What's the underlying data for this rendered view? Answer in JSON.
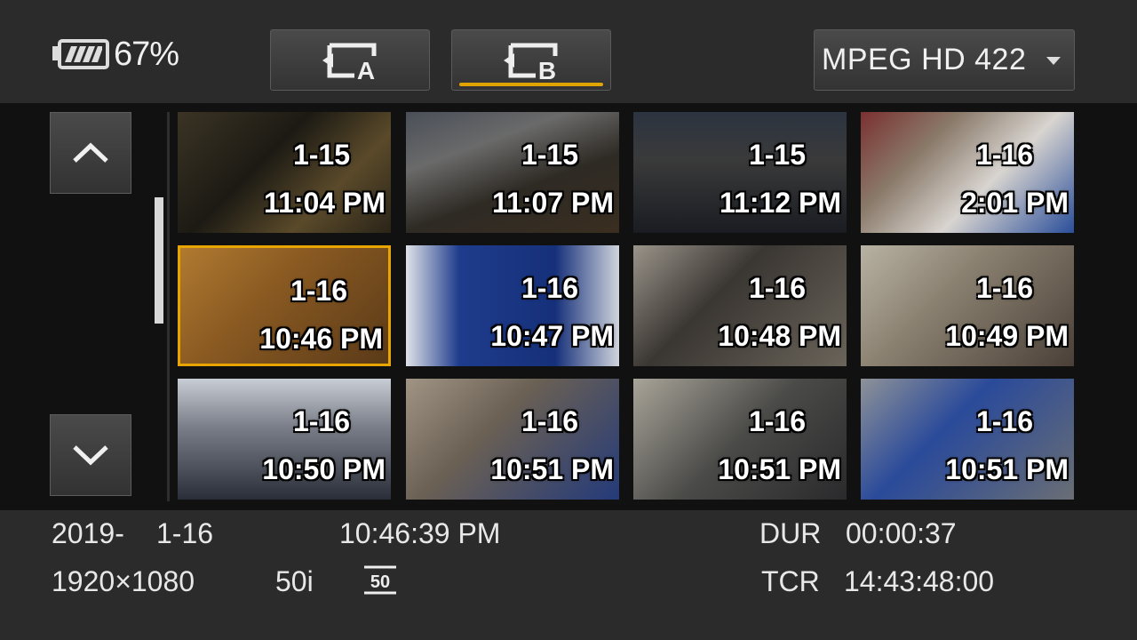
{
  "status": {
    "battery_percent": "67%"
  },
  "slots": [
    {
      "label": "A",
      "active": false
    },
    {
      "label": "B",
      "active": true
    }
  ],
  "format": {
    "label": "MPEG HD 422",
    "icon": "dropdown-arrow-icon"
  },
  "navigation": {
    "up_icon": "chevron-up-icon",
    "down_icon": "chevron-down-icon"
  },
  "thumbnails": [
    {
      "date": "1-15",
      "time": "11:04 PM",
      "selected": false
    },
    {
      "date": "1-15",
      "time": "11:07 PM",
      "selected": false
    },
    {
      "date": "1-15",
      "time": "11:12 PM",
      "selected": false
    },
    {
      "date": "1-16",
      "time": "2:01 PM",
      "selected": false
    },
    {
      "date": "1-16",
      "time": "10:46 PM",
      "selected": true
    },
    {
      "date": "1-16",
      "time": "10:47 PM",
      "selected": false
    },
    {
      "date": "1-16",
      "time": "10:48 PM",
      "selected": false
    },
    {
      "date": "1-16",
      "time": "10:49 PM",
      "selected": false
    },
    {
      "date": "1-16",
      "time": "10:50 PM",
      "selected": false
    },
    {
      "date": "1-16",
      "time": "10:51 PM",
      "selected": false
    },
    {
      "date": "1-16",
      "time": "10:51 PM",
      "selected": false
    },
    {
      "date": "1-16",
      "time": "10:51 PM",
      "selected": false
    }
  ],
  "clip_info": {
    "year": "2019-",
    "date": "1-16",
    "time": "10:46:39 PM",
    "dur_label": "DUR",
    "duration": "00:00:37",
    "resolution": "1920×1080",
    "frame_rate": "50i",
    "rate_badge": "50",
    "tcr_label": "TCR",
    "timecode": "14:43:48:00"
  },
  "colors": {
    "accent": "#e8a400",
    "background": "#2b2b2b",
    "grid_background": "#111111"
  }
}
